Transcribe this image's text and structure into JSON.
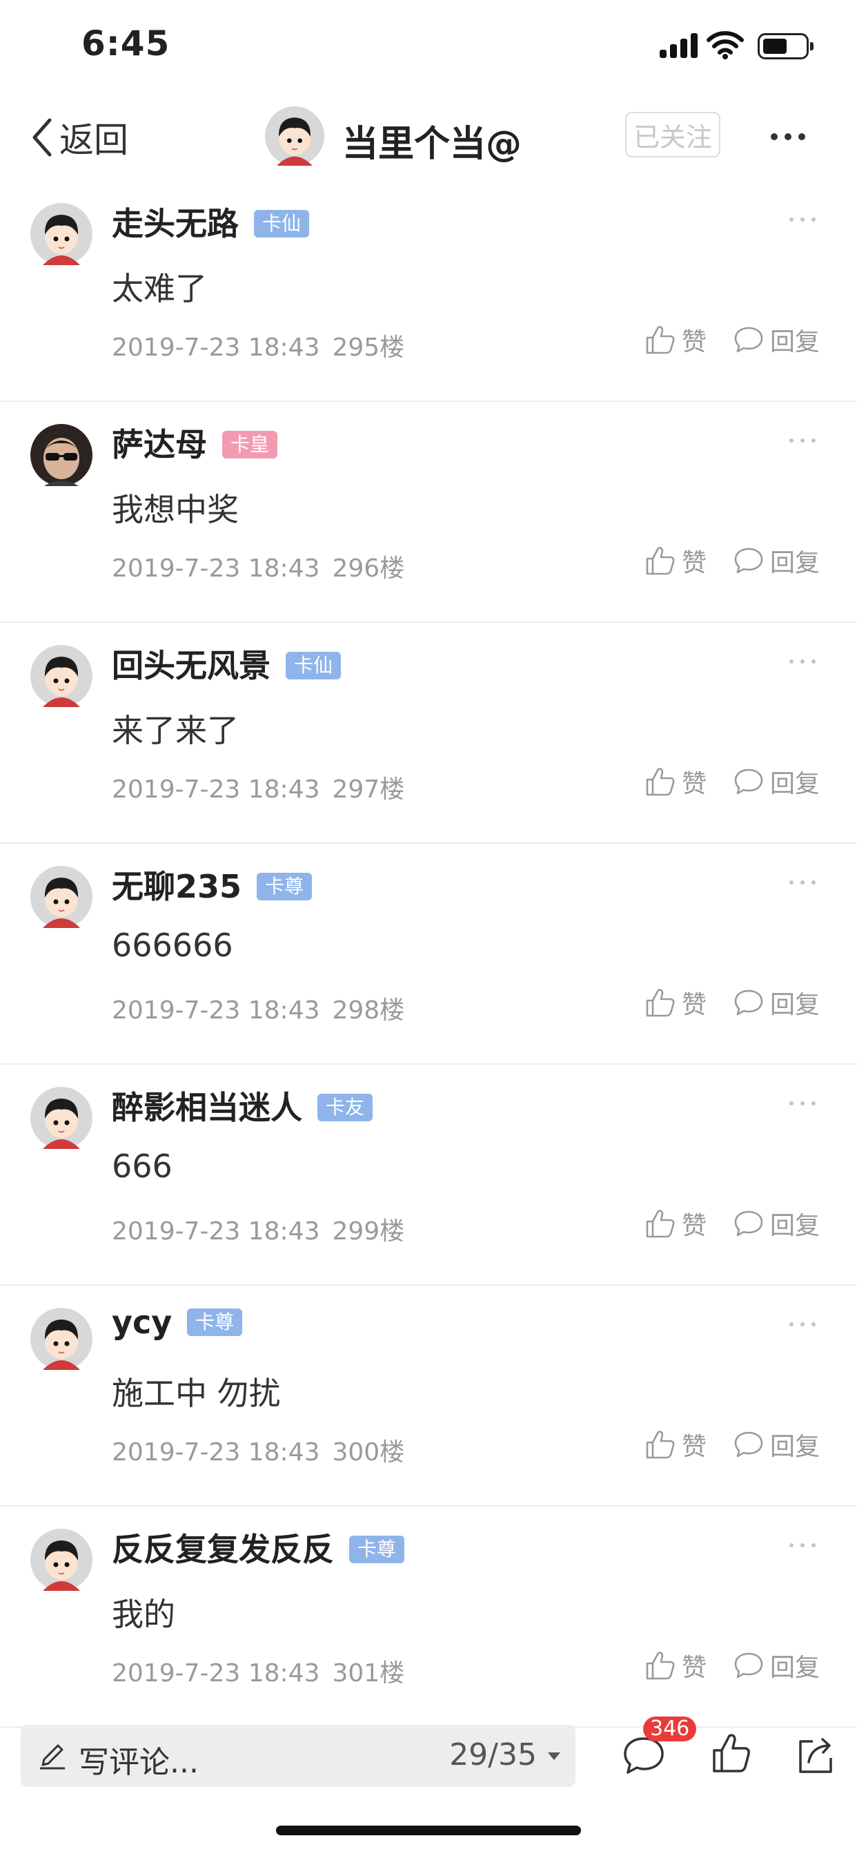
{
  "status_bar": {
    "time": "6:45"
  },
  "nav": {
    "back_label": "返回",
    "title": "当里个当@",
    "follow_label": "已关注"
  },
  "comments": [
    {
      "name": "走头无路",
      "badge": "卡仙",
      "badge_color": "#8fb4ea",
      "content": "太难了",
      "time": "2019-7-23 18:43",
      "floor": "295楼",
      "avatar": "cartoon-avatar"
    },
    {
      "name": "萨达母",
      "badge": "卡皇",
      "badge_color": "#f29bb0",
      "content": "我想中奖",
      "time": "2019-7-23 18:43",
      "floor": "296楼",
      "avatar": "photo-avatar"
    },
    {
      "name": "回头无风景",
      "badge": "卡仙",
      "badge_color": "#8fb4ea",
      "content": "来了来了",
      "time": "2019-7-23 18:43",
      "floor": "297楼",
      "avatar": "cartoon-avatar"
    },
    {
      "name": "无聊235",
      "badge": "卡尊",
      "badge_color": "#8fb4ea",
      "content": "666666",
      "time": "2019-7-23 18:43",
      "floor": "298楼",
      "avatar": "cartoon-avatar"
    },
    {
      "name": "醉影相当迷人",
      "badge": "卡友",
      "badge_color": "#8fb4ea",
      "content": "666",
      "time": "2019-7-23 18:43",
      "floor": "299楼",
      "avatar": "cartoon-avatar"
    },
    {
      "name": "ycy",
      "badge": "卡尊",
      "badge_color": "#8fb4ea",
      "content": "施工中 勿扰",
      "time": "2019-7-23 18:43",
      "floor": "300楼",
      "avatar": "cartoon-avatar"
    },
    {
      "name": "反反复复发反反",
      "badge": "卡尊",
      "badge_color": "#8fb4ea",
      "content": "我的",
      "time": "2019-7-23 18:43",
      "floor": "301楼",
      "avatar": "cartoon-avatar"
    }
  ],
  "actions": {
    "like_label": "赞",
    "reply_label": "回复"
  },
  "bottom_bar": {
    "comment_placeholder": "写评论...",
    "page_indicator": "29/35",
    "comment_count": "346"
  }
}
